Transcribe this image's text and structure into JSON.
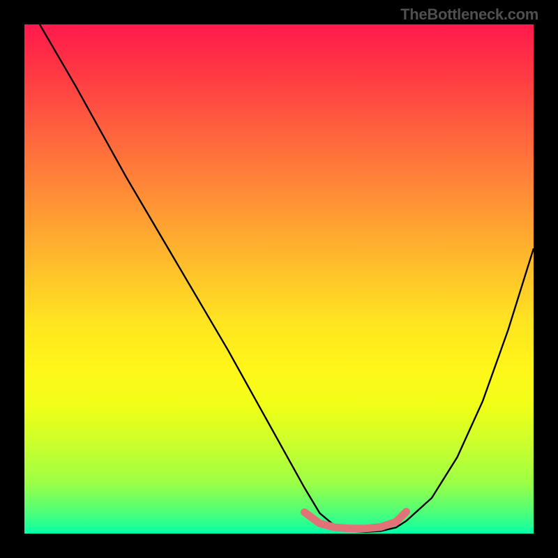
{
  "watermark": "TheBottleneck.com",
  "chart_data": {
    "type": "line",
    "title": "",
    "xlabel": "",
    "ylabel": "",
    "x_range": [
      0,
      100
    ],
    "y_range": [
      0,
      100
    ],
    "series": [
      {
        "name": "curve",
        "color": "#000000",
        "x": [
          3,
          10,
          20,
          30,
          40,
          50,
          55,
          58,
          61,
          64,
          67,
          70,
          73,
          75,
          80,
          85,
          90,
          95,
          100
        ],
        "y": [
          100,
          88,
          70,
          53,
          36,
          18,
          9,
          4,
          1.5,
          0.5,
          0.3,
          0.5,
          1.2,
          2.5,
          7,
          15,
          26,
          40,
          56
        ]
      },
      {
        "name": "bottom-marker",
        "color": "#e17277",
        "x": [
          55,
          58,
          61,
          64,
          67,
          70,
          73,
          75
        ],
        "y": [
          4.2,
          2.0,
          1.2,
          1.0,
          1.0,
          1.3,
          2.3,
          4.3
        ]
      }
    ],
    "background_gradient": {
      "top": "#ff1a4d",
      "mid": "#fff718",
      "bottom": "#00ffae"
    }
  }
}
